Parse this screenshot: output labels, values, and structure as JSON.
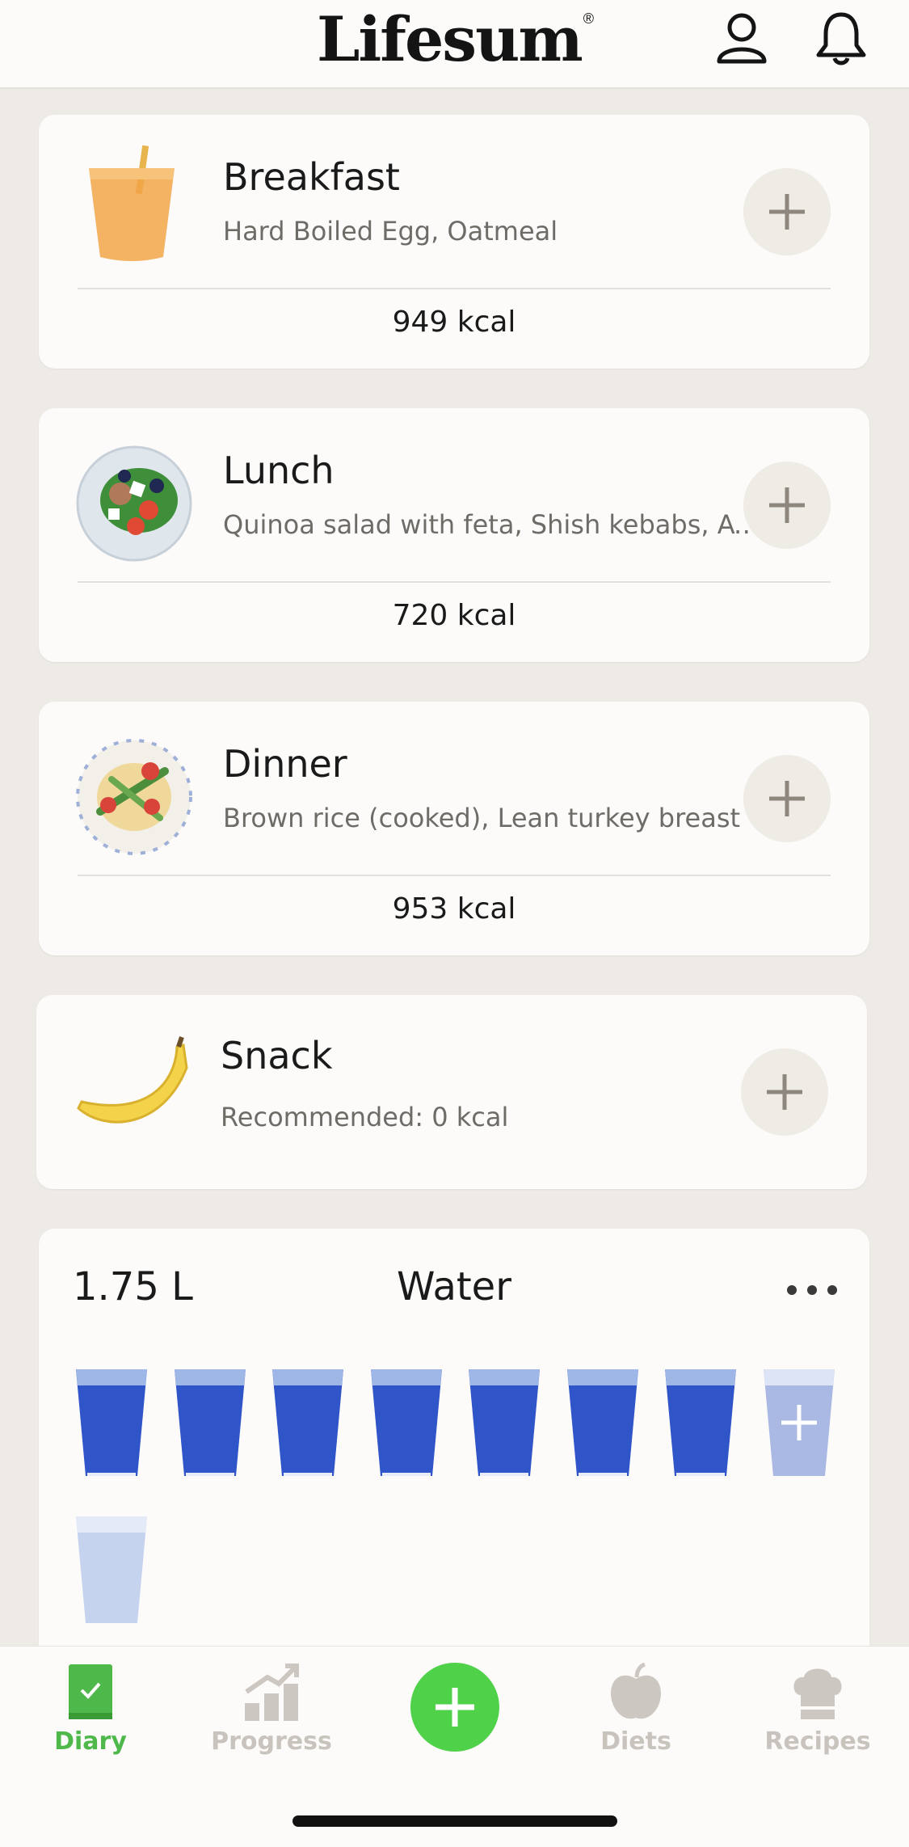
{
  "header": {
    "logo": "Lifesum",
    "logo_mark": "®",
    "profile_icon": "profile-icon",
    "bell_icon": "bell-icon"
  },
  "meals": [
    {
      "title": "Breakfast",
      "subtitle": "Hard Boiled Egg, Oatmeal",
      "kcal": "949 kcal"
    },
    {
      "title": "Lunch",
      "subtitle": "Quinoa salad with feta, Shish kebabs, Avocado",
      "kcal": "720 kcal"
    },
    {
      "title": "Dinner",
      "subtitle": "Brown rice (cooked), Lean turkey breast",
      "kcal": "953 kcal"
    }
  ],
  "snack": {
    "title": "Snack",
    "subtitle": "Recommended: 0  kcal"
  },
  "water": {
    "amount": "1.75 L",
    "title": "Water",
    "filled_glasses": 7,
    "total_glasses_shown": 9
  },
  "tabs": [
    {
      "label": "Diary",
      "icon": "diary-icon",
      "active": true
    },
    {
      "label": "Progress",
      "icon": "progress-icon",
      "active": false
    },
    {
      "label": "Diets",
      "icon": "apple-icon",
      "active": false
    },
    {
      "label": "Recipes",
      "icon": "chef-hat-icon",
      "active": false
    }
  ],
  "colors": {
    "accent_green": "#4fd24a",
    "tab_active": "#4fb84a",
    "water_blue": "#2f55c8"
  }
}
